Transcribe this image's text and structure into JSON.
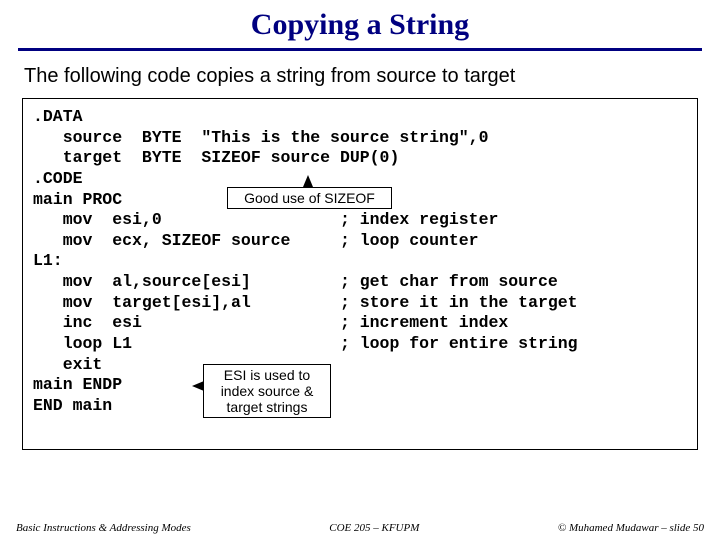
{
  "title": "Copying a String",
  "subtitle": "The following code copies a string from source to target",
  "code": ".DATA\n   source  BYTE  \"This is the source string\",0\n   target  BYTE  SIZEOF source DUP(0)\n.CODE\nmain PROC\n   mov  esi,0                  ; index register\n   mov  ecx, SIZEOF source     ; loop counter\nL1:\n   mov  al,source[esi]         ; get char from source\n   mov  target[esi],al         ; store it in the target\n   inc  esi                    ; increment index\n   loop L1                     ; loop for entire string\n   exit\nmain ENDP\nEND main",
  "callout1": "Good use of SIZEOF",
  "callout2": "ESI is used to index source & target strings",
  "footer": {
    "left": "Basic Instructions & Addressing Modes",
    "center": "COE 205 – KFUPM",
    "right": "© Muhamed Mudawar – slide 50"
  }
}
